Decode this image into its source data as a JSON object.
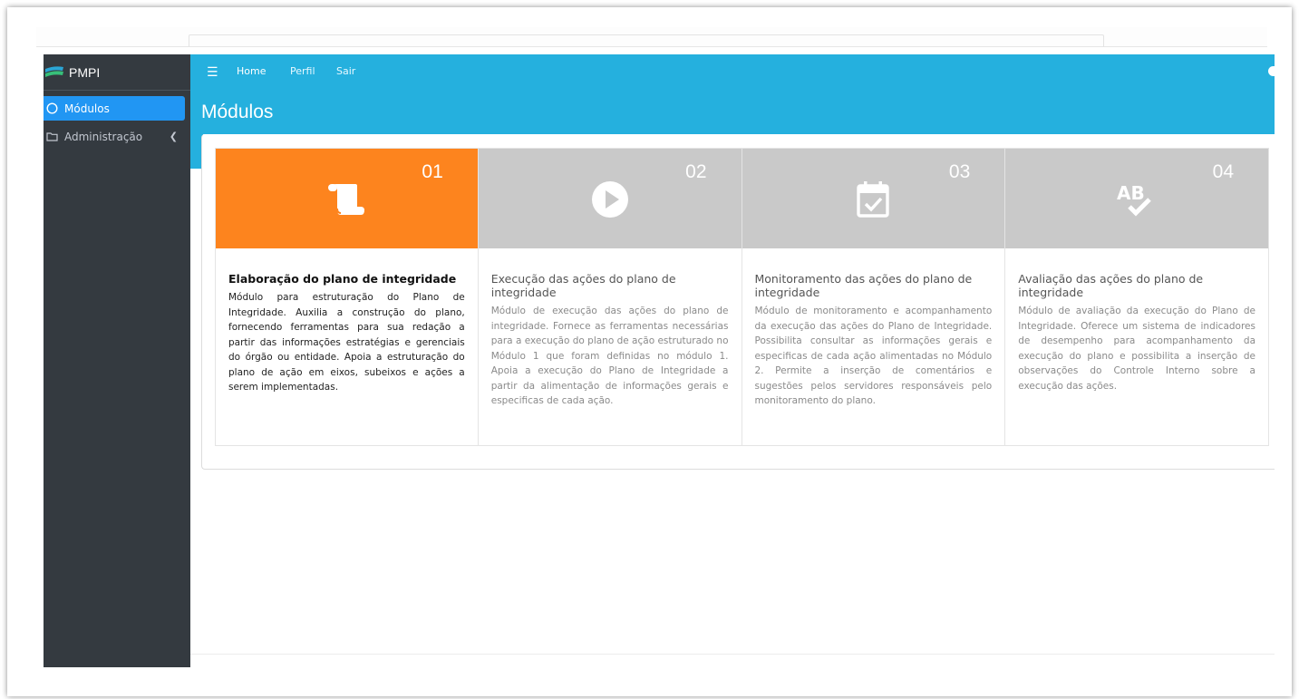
{
  "brand": {
    "name": "PMPI"
  },
  "sidebar": {
    "items": [
      {
        "label": "Módulos",
        "icon": "circle-icon",
        "active": true
      },
      {
        "label": "Administração",
        "icon": "folder-icon",
        "active": false
      }
    ]
  },
  "topbar": {
    "links": [
      {
        "label": "Home"
      },
      {
        "label": "Perfil"
      },
      {
        "label": "Sair"
      }
    ]
  },
  "page": {
    "title": "Módulos"
  },
  "modules": [
    {
      "number": "01",
      "icon": "scroll-icon",
      "title": "Elaboração do plano de integridade",
      "description": "Módulo para estruturação do Plano de Integridade. Auxilia a construção do plano, fornecendo ferramentas para sua redação a partir das informações estratégias e gerenciais do órgão ou entidade. Apoia a estruturação do plano de ação em eixos, subeixos e ações a serem implementadas."
    },
    {
      "number": "02",
      "icon": "play-circle-icon",
      "title": "Execução das ações do plano de integridade",
      "description": "Módulo de execução das ações do plano de integridade. Fornece as ferramentas necessárias para a execução do plano de ação estruturado no Módulo 1 que foram definidas no módulo 1. Apoia a execução do Plano de Integridade a partir da alimentação de informações gerais e especificas de cada ação."
    },
    {
      "number": "03",
      "icon": "calendar-check-icon",
      "title": "Monitoramento das ações do plano de integridade",
      "description": "Módulo de monitoramento e acompanhamento da execução das ações do Plano de Integridade. Possibilita consultar as informações gerais e especificas de cada ação alimentadas no Módulo 2. Permite a inserção de comentários e sugestões pelos servidores responsáveis pelo monitoramento do plano."
    },
    {
      "number": "04",
      "icon": "spell-check-icon",
      "title": "Avaliação das ações do plano de integridade",
      "description": "Módulo de avaliação da execução do Plano de Integridade. Oferece um sistema de indicadores de desempenho para acompanhamento da execução do plano e possibilita a inserção de observações do Controle Interno sobre a execução das ações."
    }
  ],
  "colors": {
    "topbar": "#25b0de",
    "sidebar": "#343a40",
    "active_nav": "#2196f3",
    "module_active": "#fd841e",
    "module_inactive": "#c9c9c9"
  }
}
